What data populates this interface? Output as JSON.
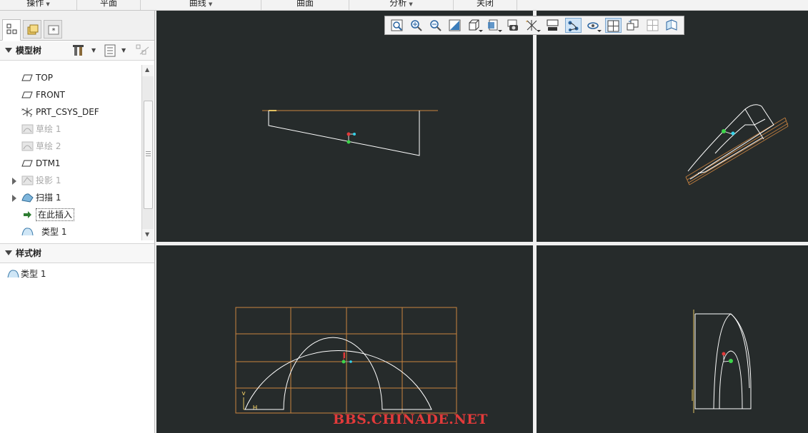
{
  "menubar": {
    "items": [
      {
        "label": "操作",
        "has_dropdown": true
      },
      {
        "label": "平面",
        "has_dropdown": false
      },
      {
        "label": "曲线",
        "has_dropdown": true
      },
      {
        "label": "曲面",
        "has_dropdown": false
      },
      {
        "label": "分析",
        "has_dropdown": true
      },
      {
        "label": "关闭",
        "has_dropdown": false
      }
    ]
  },
  "left_panel": {
    "tabs": [
      {
        "icon": "model-tree-tab-icon",
        "active": true
      },
      {
        "icon": "folder-browser-tab-icon",
        "active": false
      },
      {
        "icon": "favorites-tab-icon",
        "active": false
      }
    ],
    "model_tree": {
      "title": "模型树",
      "items": [
        {
          "label": "TOP",
          "icon": "datum-plane-icon",
          "greyed": false,
          "expandable": false
        },
        {
          "label": "FRONT",
          "icon": "datum-plane-icon",
          "greyed": false,
          "expandable": false
        },
        {
          "label": "PRT_CSYS_DEF",
          "icon": "coordinate-system-icon",
          "greyed": false,
          "expandable": false
        },
        {
          "label": "草绘 1",
          "icon": "sketch-icon",
          "greyed": true,
          "expandable": false
        },
        {
          "label": "草绘 2",
          "icon": "sketch-icon",
          "greyed": true,
          "expandable": false
        },
        {
          "label": "DTM1",
          "icon": "datum-plane-icon",
          "greyed": false,
          "expandable": false
        },
        {
          "label": "投影 1",
          "icon": "projection-icon",
          "greyed": true,
          "expandable": true
        },
        {
          "label": "扫描 1",
          "icon": "sweep-icon",
          "greyed": false,
          "expandable": true
        },
        {
          "label": "在此插入",
          "icon": "insert-here-arrow-icon",
          "greyed": false,
          "expandable": false
        },
        {
          "label": "类型 1",
          "icon": "style-feature-icon",
          "greyed": false,
          "expandable": false
        }
      ]
    },
    "style_tree": {
      "title": "样式树",
      "items": [
        {
          "label": "类型 1",
          "icon": "style-feature-icon"
        }
      ]
    }
  },
  "view_toolbar": {
    "buttons": [
      {
        "icon": "refit-icon",
        "active": false
      },
      {
        "icon": "zoom-in-icon",
        "active": false
      },
      {
        "icon": "zoom-out-icon",
        "active": false
      },
      {
        "icon": "repaint-icon",
        "active": false
      },
      {
        "icon": "display-style-icon",
        "active": false
      },
      {
        "icon": "saved-orientations-icon",
        "active": false
      },
      {
        "icon": "view-manager-icon",
        "active": false
      },
      {
        "icon": "datum-display-icon",
        "active": false
      },
      {
        "icon": "curve-display-icon",
        "active": false
      },
      {
        "icon": "curve-points-icon",
        "active": true
      },
      {
        "icon": "spin-center-icon",
        "active": false
      },
      {
        "icon": "four-views-icon",
        "active": true
      },
      {
        "icon": "active-view-icon",
        "active": false
      },
      {
        "icon": "grid-display-icon",
        "active": false
      },
      {
        "icon": "surface-display-icon",
        "active": false
      }
    ]
  },
  "colors": {
    "viewport_bg": "#262b2b",
    "geometry_line": "#ffffff",
    "datum_grid": "#c9843f",
    "csys_red": "#e23a3a",
    "csys_green": "#3dd64a",
    "csys_cyan": "#35d2e8",
    "watermark": "#e23a3a"
  },
  "watermark": "BBS.CHINADE.NET"
}
